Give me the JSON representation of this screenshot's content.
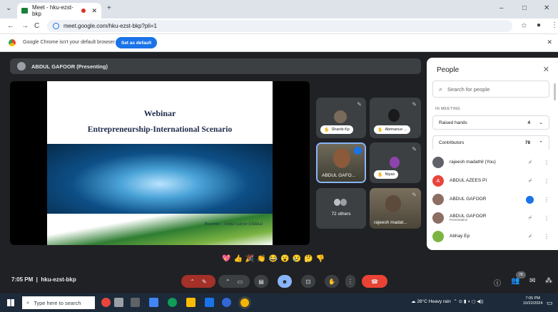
{
  "browser": {
    "tab_title": "Meet - hku-ezst-bkp",
    "url": "meet.google.com/hku-ezst-bkp?pli=1",
    "infobar_text": "Google Chrome isn't your default browser",
    "set_default_label": "Set as default"
  },
  "meet": {
    "presenting_label": "ABDUL GAFOOR (Presenting)",
    "slide": {
      "title": "Webinar",
      "subtitle": "Entrepreneurship-International Scenario",
      "presenter": "Presenter : Abdul Gafoor Ullikkal"
    },
    "tiles": [
      {
        "name": "Shanib Kp"
      },
      {
        "name": "Abimanue ..."
      },
      {
        "name": "ABDUL GAFO..."
      },
      {
        "name": "Niyas"
      },
      {
        "name": "72 others"
      },
      {
        "name": "rajeesh madat..."
      }
    ],
    "reactions": [
      "💖",
      "👍",
      "🎉",
      "👏",
      "😂",
      "😮",
      "😢",
      "🤔",
      "👎"
    ],
    "meeting_time": "7:05 PM",
    "meeting_code": "hku-ezst-bkp",
    "people_badge": "78",
    "accent": "#1a73e8",
    "end_call_color": "#ea4335"
  },
  "people": {
    "title": "People",
    "search_placeholder": "Search for people",
    "section": "IN MEETING",
    "raised_hands": {
      "label": "Raised hands",
      "count": "4"
    },
    "contributors": {
      "label": "Contributors",
      "count": "78"
    },
    "rows": [
      {
        "name": "rajeesh madathil (You)",
        "sub": ""
      },
      {
        "name": "ABDUL AZEES PI",
        "sub": ""
      },
      {
        "name": "ABDUL GAFOOR",
        "sub": ""
      },
      {
        "name": "ABDUL GAFOOR",
        "sub": "Presentation"
      },
      {
        "name": "Abhay Ep",
        "sub": ""
      }
    ]
  },
  "taskbar": {
    "search_placeholder": "Type here to search",
    "weather": "28°C  Heavy rain",
    "clock_time": "7:05 PM",
    "clock_date": "10/22/2024"
  }
}
